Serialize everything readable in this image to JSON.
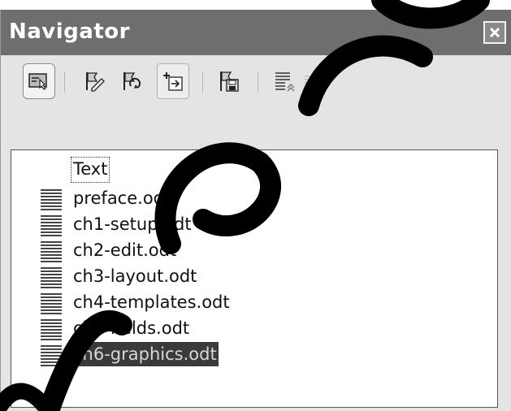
{
  "window": {
    "title": "Navigator",
    "close_icon": "close-icon"
  },
  "toolbar": {
    "buttons": [
      {
        "icon": "navigator-toggle-icon",
        "state": "pressed"
      },
      {
        "icon": "edit-flag-icon",
        "state": "normal"
      },
      {
        "icon": "update-flag-icon",
        "state": "normal"
      },
      {
        "icon": "insert-icon",
        "state": "hover"
      },
      {
        "icon": "save-contents-icon",
        "state": "normal"
      },
      {
        "icon": "demote-chapter-icon",
        "state": "normal"
      },
      {
        "icon": "promote-chapter-icon",
        "state": "disabled"
      }
    ]
  },
  "tree": {
    "root": "Text",
    "items": [
      {
        "label": "preface.odt",
        "selected": false
      },
      {
        "label": "ch1-setup.odt",
        "selected": false
      },
      {
        "label": "ch2-edit.odt",
        "selected": false
      },
      {
        "label": "ch3-layout.odt",
        "selected": false
      },
      {
        "label": "ch4-templates.odt",
        "selected": false
      },
      {
        "label": "ch5-fields.odt",
        "selected": false
      },
      {
        "label": "ch6-graphics.odt",
        "selected": true
      }
    ]
  },
  "colors": {
    "titlebar": "#6e6e6e",
    "selection": "#3a3a3a",
    "watermark": "#000000"
  }
}
